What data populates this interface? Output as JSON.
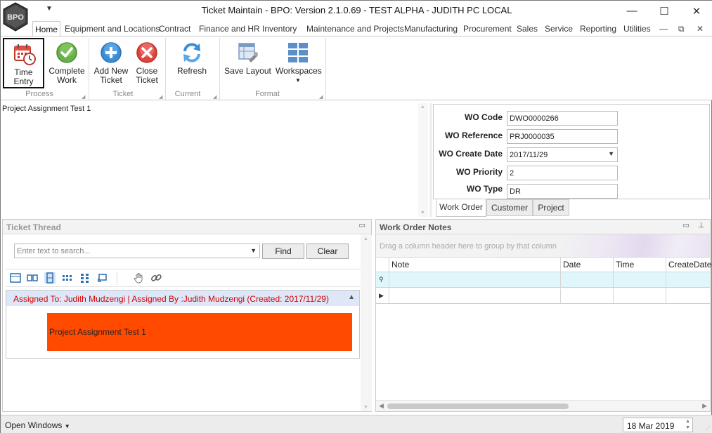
{
  "window": {
    "title": "Ticket Maintain - BPO: Version 2.1.0.69 - TEST ALPHA - JUDITH PC LOCAL",
    "logo_text": "BPO",
    "qat_icon": "dropdown-arrow-icon",
    "controls": {
      "minimize": "—",
      "maximize": "☐",
      "close": "✕"
    }
  },
  "ribbon": {
    "tabs": [
      "Home",
      "Equipment and Locations",
      "Contract",
      "Finance and HR",
      "Inventory",
      "Maintenance and Projects",
      "Manufacturing",
      "Procurement",
      "Sales",
      "Service",
      "Reporting",
      "Utilities"
    ],
    "active_tab": "Home",
    "tab_controls": {
      "minimize": "—",
      "restore": "⧉",
      "close": "✕"
    },
    "groups": {
      "process": {
        "label": "Process",
        "time_entry": "Time Entry",
        "complete_work_1": "Complete",
        "complete_work_2": "Work"
      },
      "ticket": {
        "label": "Ticket",
        "add_new_1": "Add New",
        "add_new_2": "Ticket",
        "close_1": "Close",
        "close_2": "Ticket"
      },
      "current": {
        "label": "Current",
        "refresh": "Refresh"
      },
      "format": {
        "label": "Format",
        "save_layout": "Save Layout",
        "workspaces": "Workspaces"
      }
    }
  },
  "description": {
    "text": "Project Assignment Test 1"
  },
  "work_order": {
    "fields": [
      {
        "label": "WO Code",
        "value": "DWO0000266"
      },
      {
        "label": "WO Reference",
        "value": "PRJ0000035"
      },
      {
        "label": "WO Create Date",
        "value": "2017/11/29"
      },
      {
        "label": "WO Priority",
        "value": "2"
      },
      {
        "label": "WO Type",
        "value": "DR"
      }
    ],
    "tabs": [
      "Work Order",
      "Customer",
      "Project"
    ],
    "active_tab": "Work Order"
  },
  "ticket_thread": {
    "title": "Ticket Thread",
    "search_placeholder": "Enter text to search...",
    "find_label": "Find",
    "clear_label": "Clear",
    "toolbar_icons": [
      "layout-single-icon",
      "layout-double-icon",
      "layout-columns-icon",
      "layout-grid-icon",
      "layout-tree-icon",
      "layout-rotate-icon",
      "hand-pan-icon",
      "link-icon"
    ],
    "item": {
      "header": "Assigned To: Judith Mudzengi | Assigned By :Judith Mudzengi (Created: 2017/11/29)",
      "body": "Project Assignment Test 1",
      "body_color": "#ff4a00",
      "header_color": "#d20000"
    }
  },
  "work_order_notes": {
    "title": "Work Order Notes",
    "group_hint": "Drag a column header here to group by that column",
    "columns": [
      "Note",
      "Date",
      "Time",
      "CreateDate"
    ]
  },
  "statusbar": {
    "open_windows": "Open Windows",
    "date": "18 Mar 2019"
  }
}
